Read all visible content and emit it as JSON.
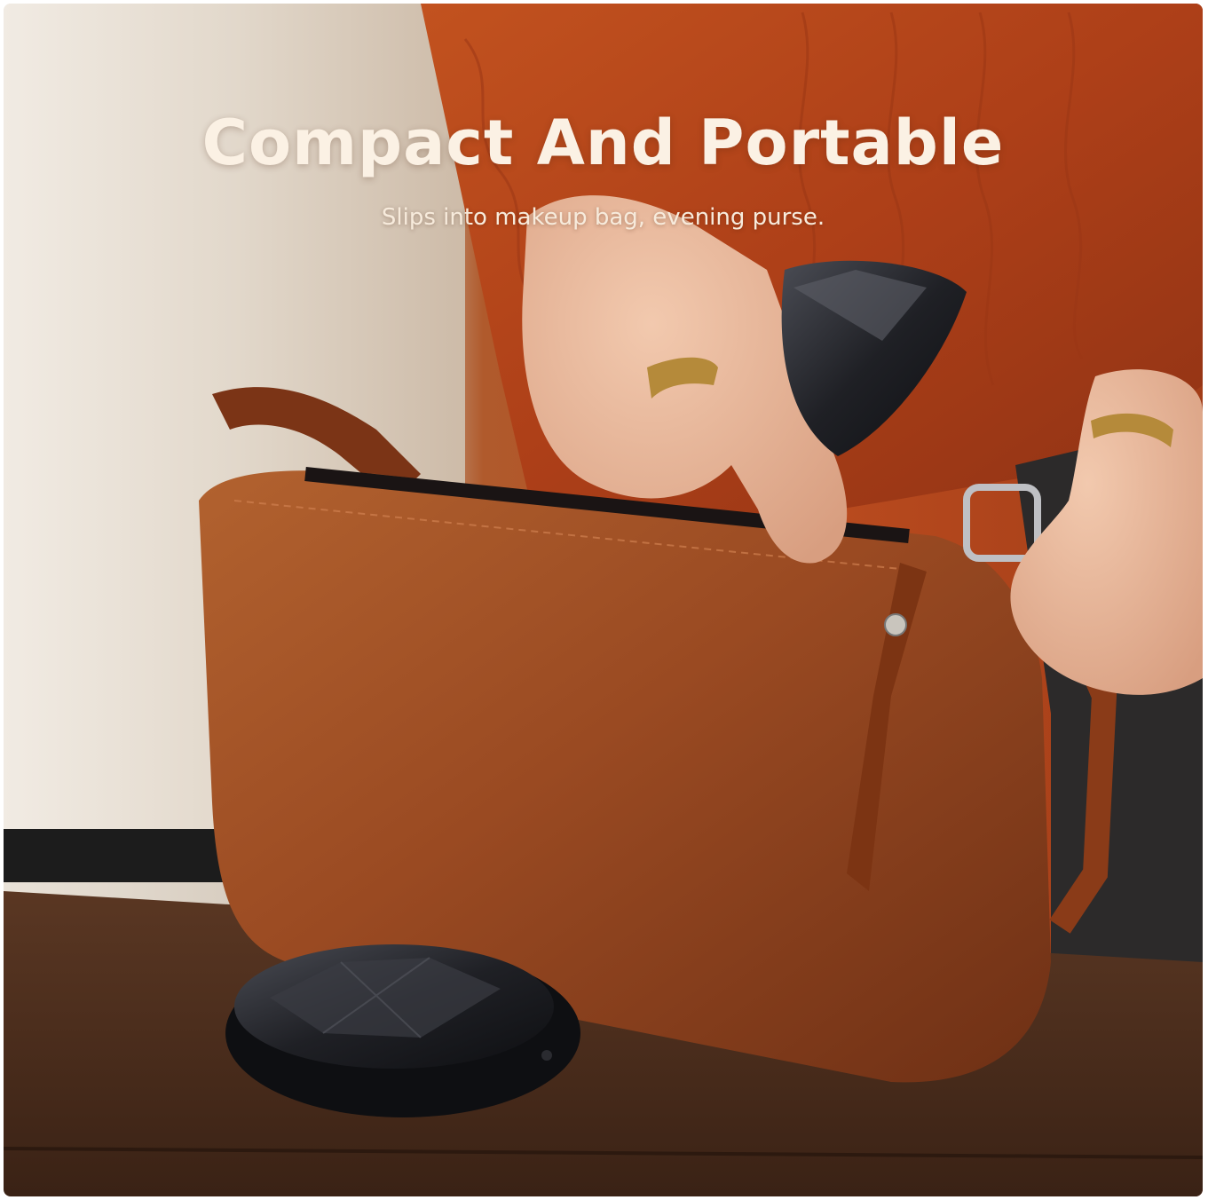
{
  "banner": {
    "title": "Compact And Portable",
    "subtitle": "Slips into makeup bag, evening purse."
  },
  "colors": {
    "headline_text": "#fbf1e4",
    "leather_bag": "#9a4a22",
    "sweater": "#b4441c",
    "device": "#1b1c20",
    "bench": "#4a2c1b"
  },
  "scene_objects": [
    "leather-handbag",
    "black-faceted-device",
    "hands",
    "wooden-bench",
    "orange-knit-sweater"
  ]
}
